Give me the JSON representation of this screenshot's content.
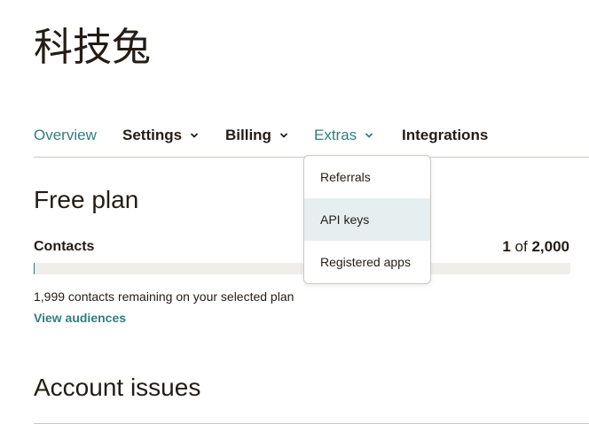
{
  "account": {
    "name": "科技兔"
  },
  "nav": {
    "tabs": [
      {
        "label": "Overview",
        "active": true
      },
      {
        "label": "Settings",
        "has_dropdown": true
      },
      {
        "label": "Billing",
        "has_dropdown": true
      },
      {
        "label": "Extras",
        "has_dropdown": true,
        "open": true
      },
      {
        "label": "Integrations"
      }
    ]
  },
  "extras_menu": {
    "items": [
      {
        "label": "Referrals"
      },
      {
        "label": "API keys",
        "highlighted": true
      },
      {
        "label": "Registered apps"
      }
    ]
  },
  "plan": {
    "title": "Free plan",
    "contacts_label": "Contacts",
    "contacts_used": "1",
    "contacts_of": "of",
    "contacts_limit": "2,000",
    "usage_fraction": 0.0005,
    "remaining_text": "1,999 contacts remaining on your selected plan",
    "view_audiences_label": "View audiences"
  },
  "issues": {
    "title": "Account issues"
  },
  "colors": {
    "accent": "#2f7f7d",
    "text": "#241c15",
    "track": "#efeeea",
    "highlight": "#e6efef",
    "divider": "#c9c9c5"
  },
  "icons": {
    "dropdown_chevron": "chevron-down-icon"
  }
}
